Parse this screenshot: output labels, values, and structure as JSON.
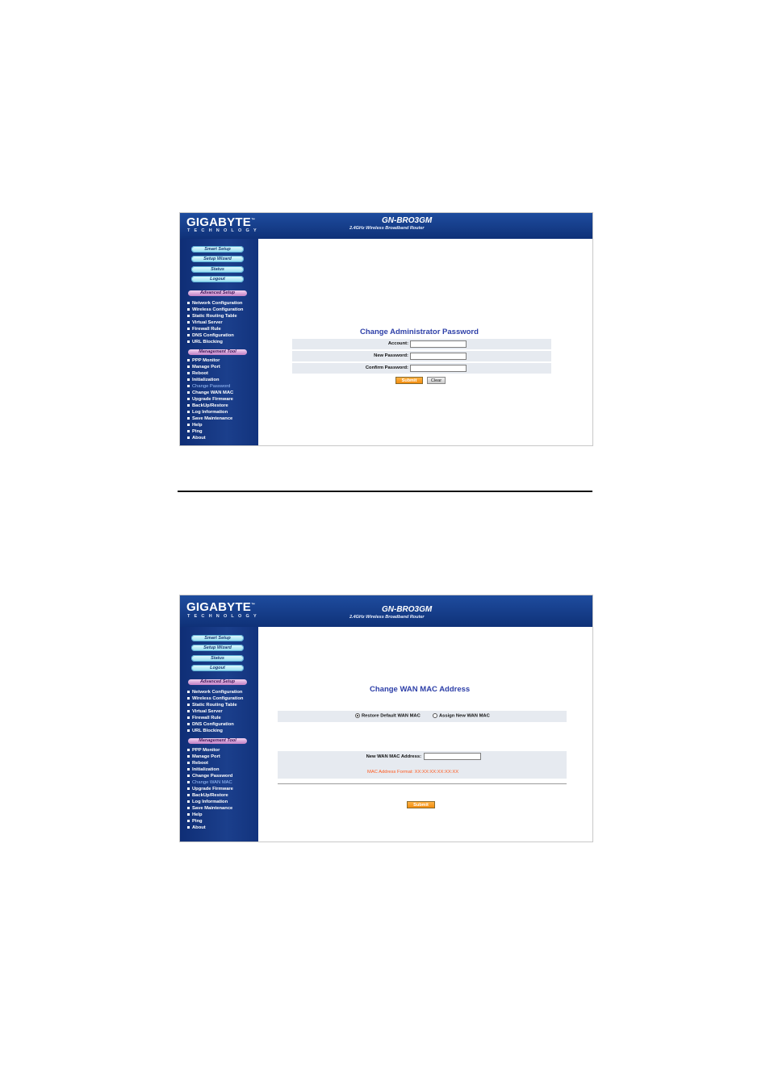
{
  "brand": {
    "logo": "GIGABYTE",
    "logo_tm": "™",
    "logo_sub": "TECHNOLOGY",
    "model": "GN-BRO3GM",
    "model_sub": "2.4GHz Wireless Broadband Router"
  },
  "sidebar": {
    "pills": [
      "Smart Setup",
      "Setup Wizard",
      "Status",
      "Logout"
    ],
    "advanced_title": "Advanced Setup",
    "advanced_items": [
      "Network Configuration",
      "Wireless Configuration",
      "Static Routing Table",
      "Virtual Server",
      "Firewall Rule",
      "DNS Configuration",
      "URL Blocking"
    ],
    "management_title": "Management Tool",
    "management_items": [
      "PPP Monitor",
      "Manage Port",
      "Reboot",
      "Initialization",
      "Change Password",
      "Change WAN MAC",
      "Upgrade Firmware",
      "BackUp/Restore",
      "Log Information",
      "Save Maintenance",
      "Help",
      "Ping",
      "About"
    ]
  },
  "screen1": {
    "title": "Change Administrator Password",
    "fields": [
      {
        "label": "Account:",
        "value": ""
      },
      {
        "label": "New Password:",
        "value": ""
      },
      {
        "label": "Confirm Password:",
        "value": ""
      }
    ],
    "submit": "Submit",
    "clear": "Clear",
    "active_item": "Change Password"
  },
  "screen2": {
    "title": "Change WAN MAC Address",
    "radio_restore": "Restore Default WAN MAC",
    "radio_assign": "Assign New WAN MAC",
    "mac_label": "New WAN MAC Address:",
    "mac_value": "",
    "mac_hint": "MAC Address Format: XX:XX:XX:XX:XX:XX",
    "submit": "Submit",
    "active_item": "Change WAN MAC"
  },
  "colors": {
    "banner": "#1e4c9e",
    "sidebar": "#0f2e76",
    "title": "#2d3fa8",
    "accent_orange": "#f28c0e",
    "hint": "#ff5a1f"
  }
}
